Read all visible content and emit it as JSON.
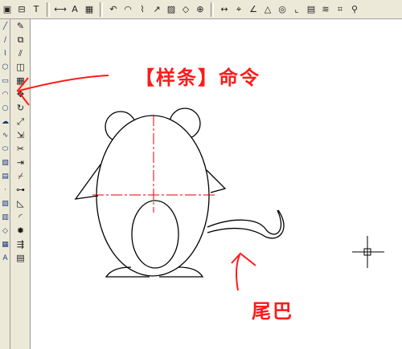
{
  "annotations": {
    "command_label": "【样条】命令",
    "tail_label": "尾巴"
  },
  "colors": {
    "annotation": "#ff1a1a",
    "centerline": "#e60000",
    "drawing": "#000000",
    "toolbar_bg": "#ece9d8"
  },
  "toolbar": {
    "icons": [
      "layout-icon",
      "print-preview-icon",
      "text-style-icon",
      "dimension-icon",
      "text-icon",
      "table-icon",
      "undo-icon",
      "arc-icon",
      "polyline-icon",
      "cursor-icon",
      "hatch-icon",
      "region-icon",
      "crosshair-icon",
      "distance-icon",
      "snap-icon",
      "angle-icon",
      "triangle-icon",
      "track-icon",
      "ucs-icon",
      "properties-icon",
      "layer-icon",
      "measure-icon",
      "zoom-icon"
    ]
  },
  "left_toolbar": {
    "draw_icons": [
      "line-icon",
      "construction-line-icon",
      "polyline-icon",
      "polygon-icon",
      "rectangle-icon",
      "arc-icon",
      "circle-icon",
      "revcloud-icon",
      "spline-icon",
      "ellipse-icon",
      "insert-block-icon",
      "make-block-icon",
      "point-icon",
      "hatch-icon",
      "gradient-icon",
      "region-icon",
      "table-icon",
      "mtext-icon"
    ],
    "modify_icons": [
      "erase-icon",
      "copy-icon",
      "mirror-icon",
      "offset-icon",
      "array-icon",
      "move-icon",
      "rotate-icon",
      "scale-icon",
      "stretch-icon",
      "trim-icon",
      "extend-icon",
      "break-icon",
      "join-icon",
      "chamfer-icon",
      "fillet-icon",
      "explode-icon",
      "align-icon",
      "properties-icon"
    ]
  }
}
